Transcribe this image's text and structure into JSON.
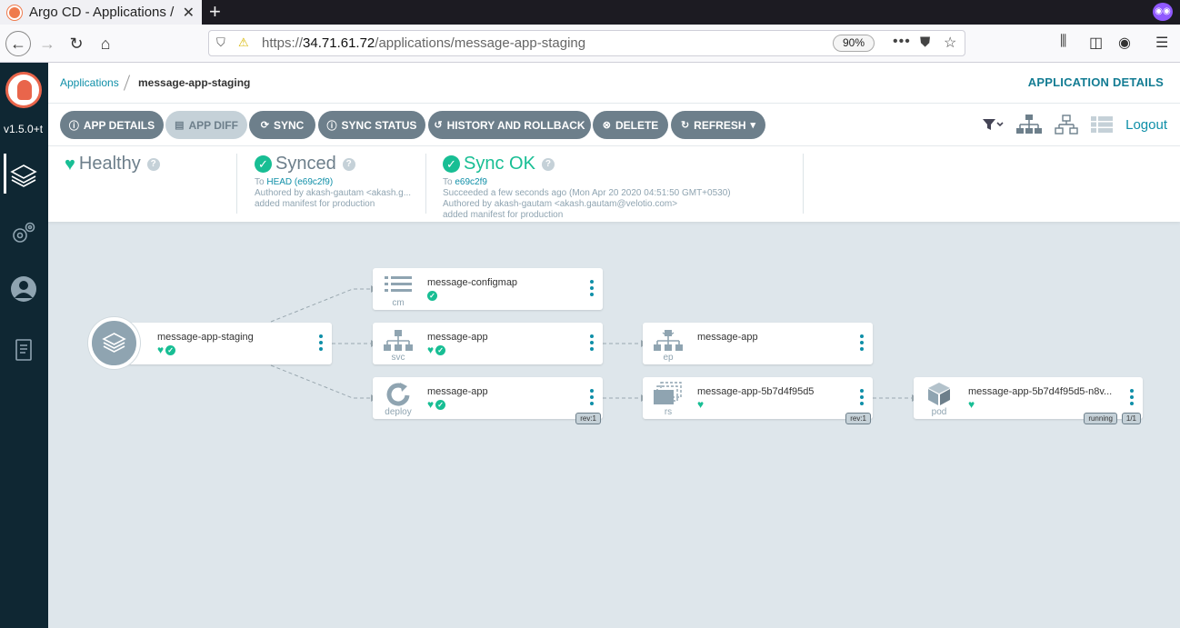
{
  "browser": {
    "tab_title": "Argo CD - Applications / m",
    "tab_close": "✕",
    "new_tab": "+",
    "url_host": "34.71.61.72",
    "url_prefix": "https://",
    "url_path": "/applications/message-app-staging",
    "zoom": "90%"
  },
  "nav": {
    "version": "v1.5.0+t"
  },
  "header": {
    "breadcrumb_root": "Applications",
    "breadcrumb_current": "message-app-staging",
    "page_title": "APPLICATION DETAILS"
  },
  "toolbar": {
    "app_details": "APP DETAILS",
    "app_diff": "APP DIFF",
    "sync": "SYNC",
    "sync_status": "SYNC STATUS",
    "history": "HISTORY AND ROLLBACK",
    "delete": "DELETE",
    "refresh": "REFRESH",
    "logout": "Logout"
  },
  "status": {
    "health": "Healthy",
    "sync": {
      "label": "Synced",
      "to_prefix": "To",
      "revision": "HEAD (e69c2f9)",
      "author": "Authored by akash-gautam <akash.g...",
      "message": "added manifest for production"
    },
    "operation": {
      "label": "Sync OK",
      "to_prefix": "To",
      "revision": "e69c2f9",
      "time": "Succeeded a few seconds ago (Mon Apr 20 2020 04:51:50 GMT+0530)",
      "author": "Authored by akash-gautam <akash.gautam@velotio.com>",
      "message": "added manifest for production"
    }
  },
  "graph": {
    "root": {
      "name": "message-app-staging"
    },
    "nodes": [
      {
        "kind": "cm",
        "name": "message-configmap"
      },
      {
        "kind": "svc",
        "name": "message-app"
      },
      {
        "kind": "deploy",
        "name": "message-app",
        "tag": "rev:1"
      },
      {
        "kind": "ep",
        "name": "message-app"
      },
      {
        "kind": "rs",
        "name": "message-app-5b7d4f95d5",
        "tag": "rev:1"
      },
      {
        "kind": "pod",
        "name": "message-app-5b7d4f95d5-n8v...",
        "tag": "running",
        "tag2": "1/1"
      }
    ]
  },
  "colors": {
    "accent": "#0f8fa8",
    "healthy": "#18be94",
    "button": "#6d7f8b",
    "nav": "#0f2733",
    "canvas": "#dee6eb"
  }
}
